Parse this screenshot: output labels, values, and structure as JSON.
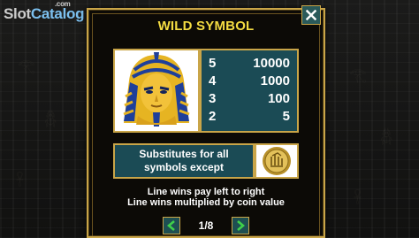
{
  "watermark": {
    "text_a": "Slot",
    "text_b": "Catalog",
    "suffix": ".com"
  },
  "dialog": {
    "title": "WILD SYMBOL",
    "close_icon": "close-icon"
  },
  "paytable": {
    "symbol_icon": "pharaoh-mask-icon",
    "rows": [
      {
        "count": "5",
        "payout": "10000"
      },
      {
        "count": "4",
        "payout": "1000"
      },
      {
        "count": "3",
        "payout": "100"
      },
      {
        "count": "2",
        "payout": "5"
      }
    ]
  },
  "substitution": {
    "line1": "Substitutes for all",
    "line2": "symbols except",
    "except_symbol_icon": "gold-coin-hieroglyph-icon"
  },
  "rules": {
    "line1": "Line wins pay left to right",
    "line2": "Line wins multiplied by coin value"
  },
  "pagination": {
    "current": "1/8",
    "prev_icon": "chevron-left-icon",
    "next_icon": "chevron-right-icon"
  },
  "colors": {
    "gold": "#c9a548",
    "title_yellow": "#f4dc42",
    "teal_panel": "#1b4b55",
    "nav_arrow_green": "#3fd14a"
  }
}
